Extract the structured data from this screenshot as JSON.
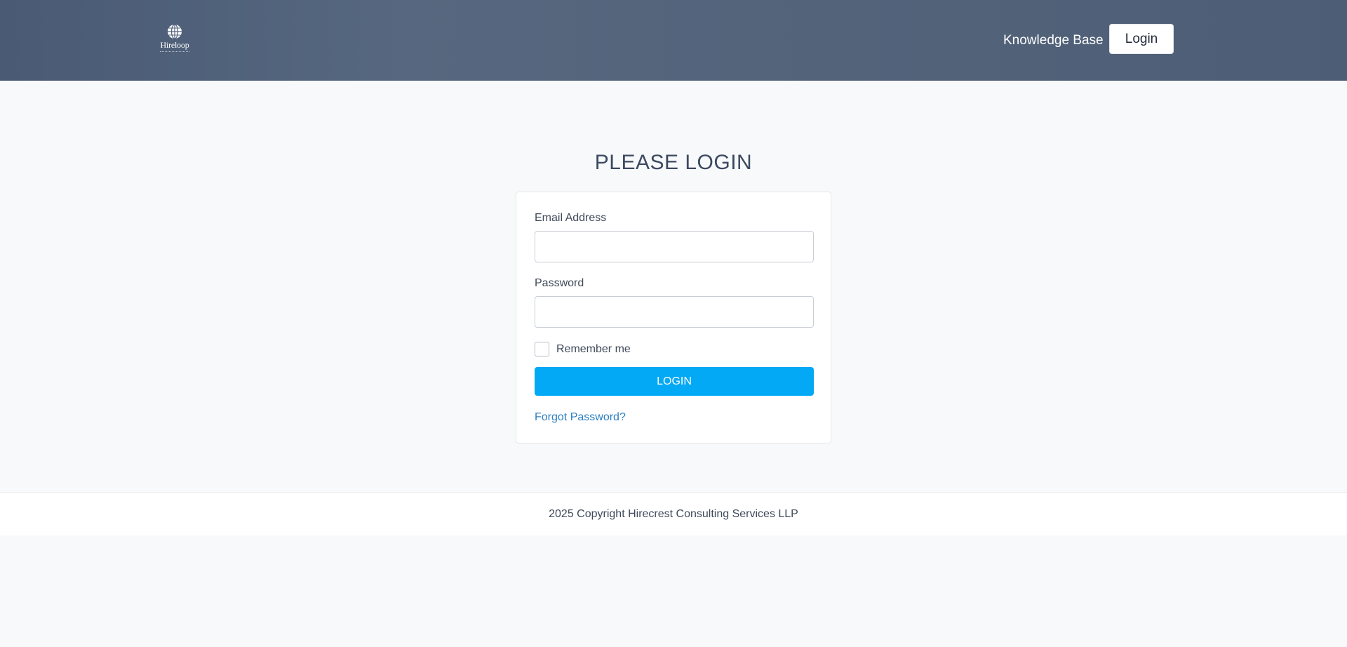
{
  "header": {
    "logo_text": "Hireloop",
    "knowledge_base_label": "Knowledge Base",
    "login_label": "Login"
  },
  "main": {
    "title": "PLEASE LOGIN",
    "form": {
      "email_label": "Email Address",
      "email_value": "",
      "email_placeholder": "",
      "password_label": "Password",
      "password_value": "",
      "password_placeholder": "",
      "remember_label": "Remember me",
      "remember_checked": false,
      "submit_label": "LOGIN",
      "forgot_label": "Forgot Password?"
    }
  },
  "footer": {
    "copyright": "2025 Copyright Hirecrest Consulting Services LLP"
  },
  "colors": {
    "header_bg": "#526279",
    "primary_button": "#03a9f4",
    "link": "#2d7fbf",
    "page_bg": "#f8f9fb"
  }
}
